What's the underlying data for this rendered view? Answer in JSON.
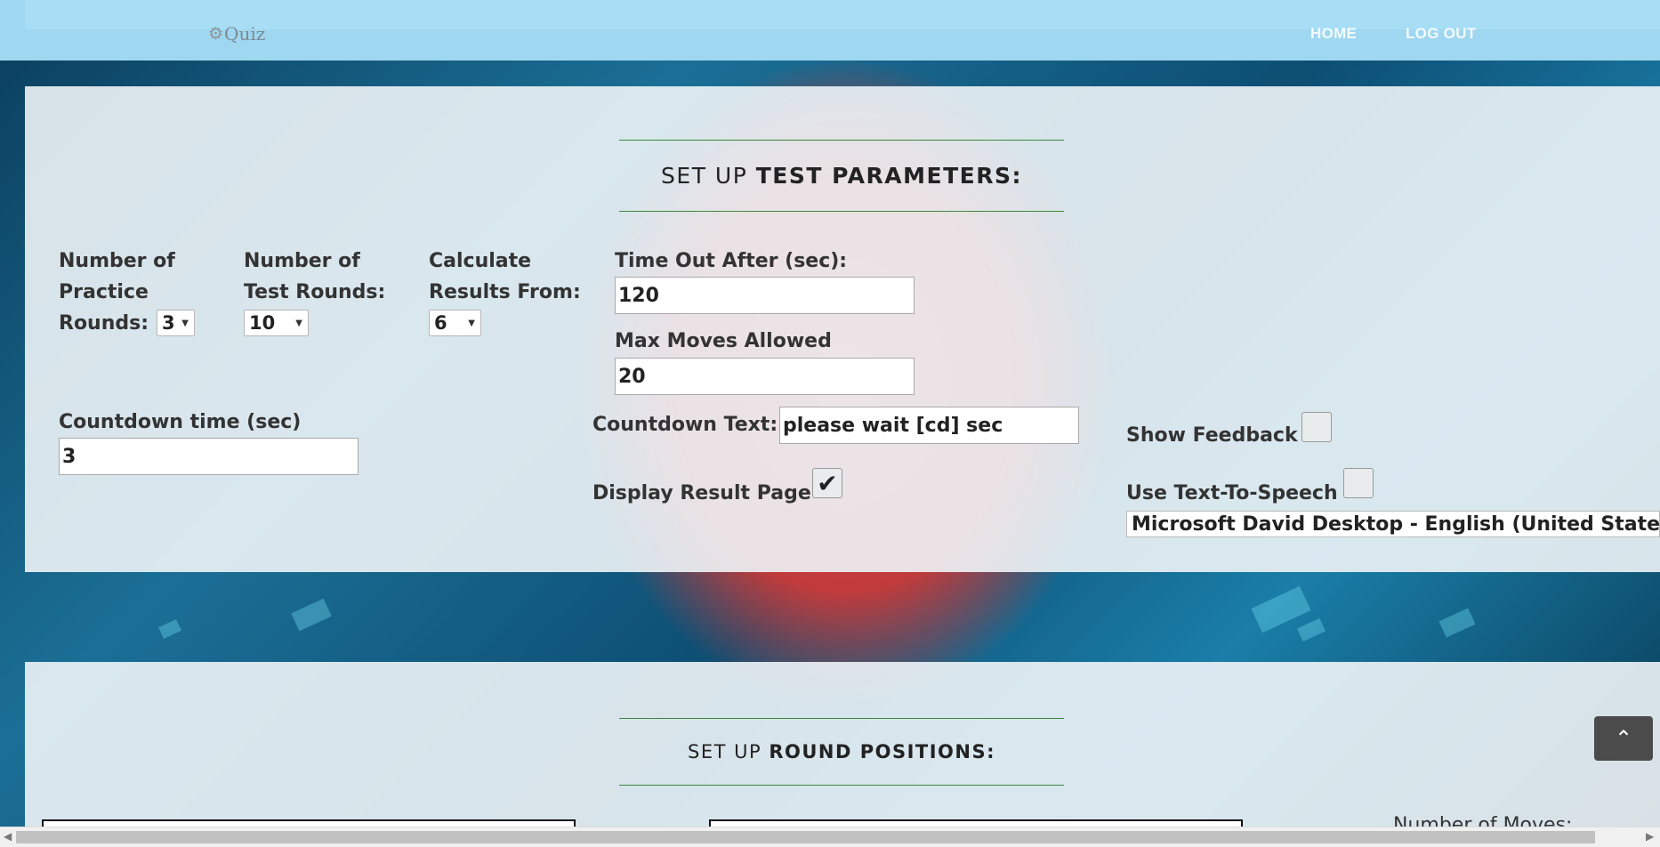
{
  "header": {
    "brand": "Quiz",
    "brand_icon": "gears-icon",
    "nav": {
      "home": "HOME",
      "logout": "LOG OUT"
    }
  },
  "test_params": {
    "title_prefix": "SET UP",
    "title_bold": "TEST PARAMETERS:",
    "practice_rounds": {
      "label_line1": "Number of",
      "label_line2": "Practice",
      "label_line3": "Rounds:",
      "value": "3"
    },
    "test_rounds": {
      "label_line1": "Number of",
      "label_line2": "Test Rounds:",
      "value": "10"
    },
    "calculate_from": {
      "label_line1": "Calculate",
      "label_line2": "Results From:",
      "value": "6"
    },
    "timeout": {
      "label": "Time Out After (sec):",
      "value": "120"
    },
    "max_moves": {
      "label": "Max Moves Allowed",
      "value": "20"
    },
    "countdown_time": {
      "label": "Countdown time (sec)",
      "value": "3"
    },
    "countdown_text": {
      "label": "Countdown Text:",
      "value": "please wait [cd] sec"
    },
    "display_result_page": {
      "label": "Display Result Page",
      "checked": true
    },
    "show_feedback": {
      "label": "Show Feedback",
      "checked": false
    },
    "text_to_speech": {
      "label": "Use Text-To-Speech",
      "checked": false,
      "voice": "Microsoft David Desktop - English (United States)"
    }
  },
  "round_positions": {
    "title_prefix": "SET UP",
    "title_bold": "ROUND POSITIONS:",
    "moves_label": "Number of Moves:"
  },
  "scroll_top_icon": "chevron-up-icon"
}
